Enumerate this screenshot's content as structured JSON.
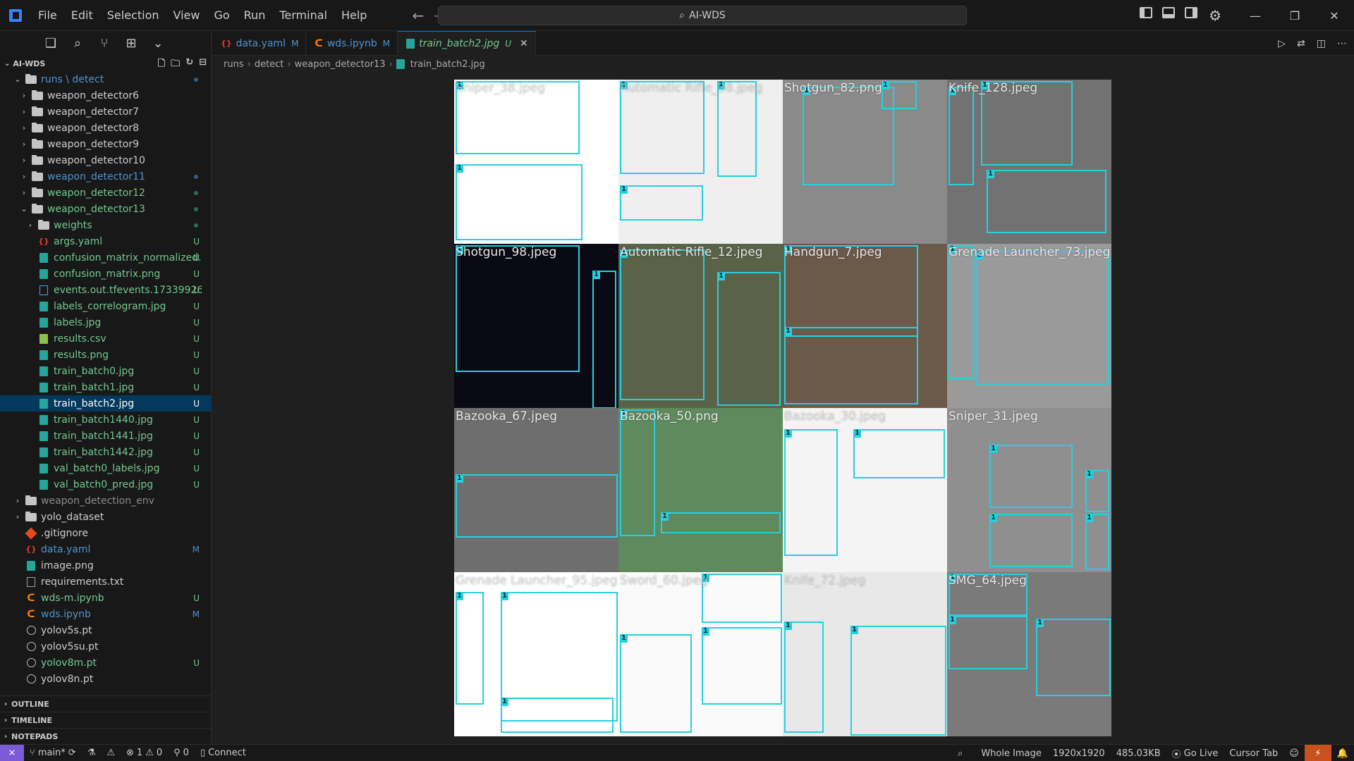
{
  "titlebar": {
    "menu": [
      "File",
      "Edit",
      "Selection",
      "View",
      "Go",
      "Run",
      "Terminal",
      "Help"
    ],
    "search_text": "AI-WDS"
  },
  "explorer": {
    "title": "AI-WDS",
    "root_path": "runs \\ detect",
    "items": [
      {
        "label": "weapon_detector6",
        "type": "folder",
        "depth": 1,
        "badge": "",
        "color": "normal",
        "twisty": "›"
      },
      {
        "label": "weapon_detector7",
        "type": "folder",
        "depth": 1,
        "badge": "",
        "color": "normal",
        "twisty": "›"
      },
      {
        "label": "weapon_detector8",
        "type": "folder",
        "depth": 1,
        "badge": "",
        "color": "normal",
        "twisty": "›"
      },
      {
        "label": "weapon_detector9",
        "type": "folder",
        "depth": 1,
        "badge": "",
        "color": "normal",
        "twisty": "›"
      },
      {
        "label": "weapon_detector10",
        "type": "folder",
        "depth": 1,
        "badge": "",
        "color": "normal",
        "twisty": "›"
      },
      {
        "label": "weapon_detector11",
        "type": "folder",
        "depth": 1,
        "badge": "dot-blue",
        "color": "modified",
        "twisty": "›"
      },
      {
        "label": "weapon_detector12",
        "type": "folder",
        "depth": 1,
        "badge": "dot",
        "color": "untracked",
        "twisty": "›"
      },
      {
        "label": "weapon_detector13",
        "type": "folder",
        "depth": 1,
        "badge": "dot",
        "color": "untracked",
        "twisty": "⌄"
      },
      {
        "label": "weights",
        "type": "folder",
        "depth": 2,
        "badge": "dot",
        "color": "untracked",
        "twisty": "›"
      },
      {
        "label": "args.yaml",
        "type": "yaml",
        "depth": 2,
        "badge": "U",
        "color": "untracked",
        "twisty": ""
      },
      {
        "label": "confusion_matrix_normalized.p...",
        "type": "img",
        "depth": 2,
        "badge": "U",
        "color": "untracked",
        "twisty": ""
      },
      {
        "label": "confusion_matrix.png",
        "type": "img",
        "depth": 2,
        "badge": "U",
        "color": "untracked",
        "twisty": ""
      },
      {
        "label": "events.out.tfevents.173399260...",
        "type": "doc",
        "depth": 2,
        "badge": "U",
        "color": "untracked",
        "twisty": ""
      },
      {
        "label": "labels_correlogram.jpg",
        "type": "img",
        "depth": 2,
        "badge": "U",
        "color": "untracked",
        "twisty": ""
      },
      {
        "label": "labels.jpg",
        "type": "img",
        "depth": 2,
        "badge": "U",
        "color": "untracked",
        "twisty": ""
      },
      {
        "label": "results.csv",
        "type": "csv",
        "depth": 2,
        "badge": "U",
        "color": "untracked",
        "twisty": ""
      },
      {
        "label": "results.png",
        "type": "img",
        "depth": 2,
        "badge": "U",
        "color": "untracked",
        "twisty": ""
      },
      {
        "label": "train_batch0.jpg",
        "type": "img",
        "depth": 2,
        "badge": "U",
        "color": "untracked",
        "twisty": ""
      },
      {
        "label": "train_batch1.jpg",
        "type": "img",
        "depth": 2,
        "badge": "U",
        "color": "untracked",
        "twisty": ""
      },
      {
        "label": "train_batch2.jpg",
        "type": "img",
        "depth": 2,
        "badge": "U",
        "color": "normal",
        "twisty": "",
        "selected": true
      },
      {
        "label": "train_batch1440.jpg",
        "type": "img",
        "depth": 2,
        "badge": "U",
        "color": "untracked",
        "twisty": ""
      },
      {
        "label": "train_batch1441.jpg",
        "type": "img",
        "depth": 2,
        "badge": "U",
        "color": "untracked",
        "twisty": ""
      },
      {
        "label": "train_batch1442.jpg",
        "type": "img",
        "depth": 2,
        "badge": "U",
        "color": "untracked",
        "twisty": ""
      },
      {
        "label": "val_batch0_labels.jpg",
        "type": "img",
        "depth": 2,
        "badge": "U",
        "color": "untracked",
        "twisty": ""
      },
      {
        "label": "val_batch0_pred.jpg",
        "type": "img",
        "depth": 2,
        "badge": "U",
        "color": "untracked",
        "twisty": ""
      },
      {
        "label": "weapon_detection_env",
        "type": "folder",
        "depth": 0,
        "badge": "",
        "color": "ignored",
        "twisty": "›"
      },
      {
        "label": "yolo_dataset",
        "type": "folder",
        "depth": 0,
        "badge": "",
        "color": "normal",
        "twisty": "›"
      },
      {
        "label": ".gitignore",
        "type": "git",
        "depth": 0,
        "badge": "",
        "color": "normal",
        "twisty": ""
      },
      {
        "label": "data.yaml",
        "type": "yaml",
        "depth": 0,
        "badge": "M",
        "color": "modified",
        "twisty": ""
      },
      {
        "label": "image.png",
        "type": "img",
        "depth": 0,
        "badge": "",
        "color": "normal",
        "twisty": ""
      },
      {
        "label": "requirements.txt",
        "type": "txt",
        "depth": 0,
        "badge": "",
        "color": "normal",
        "twisty": ""
      },
      {
        "label": "wds-m.ipynb",
        "type": "ipynb",
        "depth": 0,
        "badge": "U",
        "color": "untracked",
        "twisty": ""
      },
      {
        "label": "wds.ipynb",
        "type": "ipynb",
        "depth": 0,
        "badge": "M",
        "color": "modified",
        "twisty": ""
      },
      {
        "label": "yolov5s.pt",
        "type": "pt",
        "depth": 0,
        "badge": "",
        "color": "normal",
        "twisty": ""
      },
      {
        "label": "yolov5su.pt",
        "type": "pt",
        "depth": 0,
        "badge": "",
        "color": "normal",
        "twisty": ""
      },
      {
        "label": "yolov8m.pt",
        "type": "pt",
        "depth": 0,
        "badge": "U",
        "color": "untracked",
        "twisty": ""
      },
      {
        "label": "yolov8n.pt",
        "type": "pt",
        "depth": 0,
        "badge": "",
        "color": "normal",
        "twisty": ""
      }
    ],
    "sections": [
      "OUTLINE",
      "TIMELINE",
      "NOTEPADS"
    ]
  },
  "tabs": [
    {
      "label": "data.yaml",
      "badge": "M",
      "type": "yaml",
      "active": false
    },
    {
      "label": "wds.ipynb",
      "badge": "M",
      "type": "ipynb",
      "active": false
    },
    {
      "label": "train_batch2.jpg",
      "badge": "U",
      "type": "img",
      "active": true
    }
  ],
  "breadcrumb": [
    "runs",
    "detect",
    "weapon_detector13",
    "train_batch2.jpg"
  ],
  "mosaic": {
    "labels": [
      "Sniper_38.jpeg",
      "Automatic Rifle_38.jpeg",
      "Shotgun_82.png",
      "Knife_128.jpeg",
      "Shotgun_98.jpeg",
      "Automatic Rifle_12.jpeg",
      "Handgun_7.jpeg",
      "Grenade Launcher_73.jpeg",
      "Bazooka_67.jpeg",
      "Bazooka_50.png",
      "Bazooka_30.jpeg",
      "Sniper_31.jpeg",
      "Grenade Launcher_95.jpeg",
      "Sword_60.jpeg",
      "Knife_72.jpeg",
      "SMG_64.jpeg"
    ],
    "class_tag": "1"
  },
  "statusbar": {
    "branch": "main*",
    "errors": "1",
    "warnings": "0",
    "ports": "0",
    "connect": "Connect",
    "zoom": "Whole Image",
    "dimensions": "1920x1920",
    "filesize": "485.03KB",
    "golive": "Go Live",
    "cursortab": "Cursor Tab"
  }
}
